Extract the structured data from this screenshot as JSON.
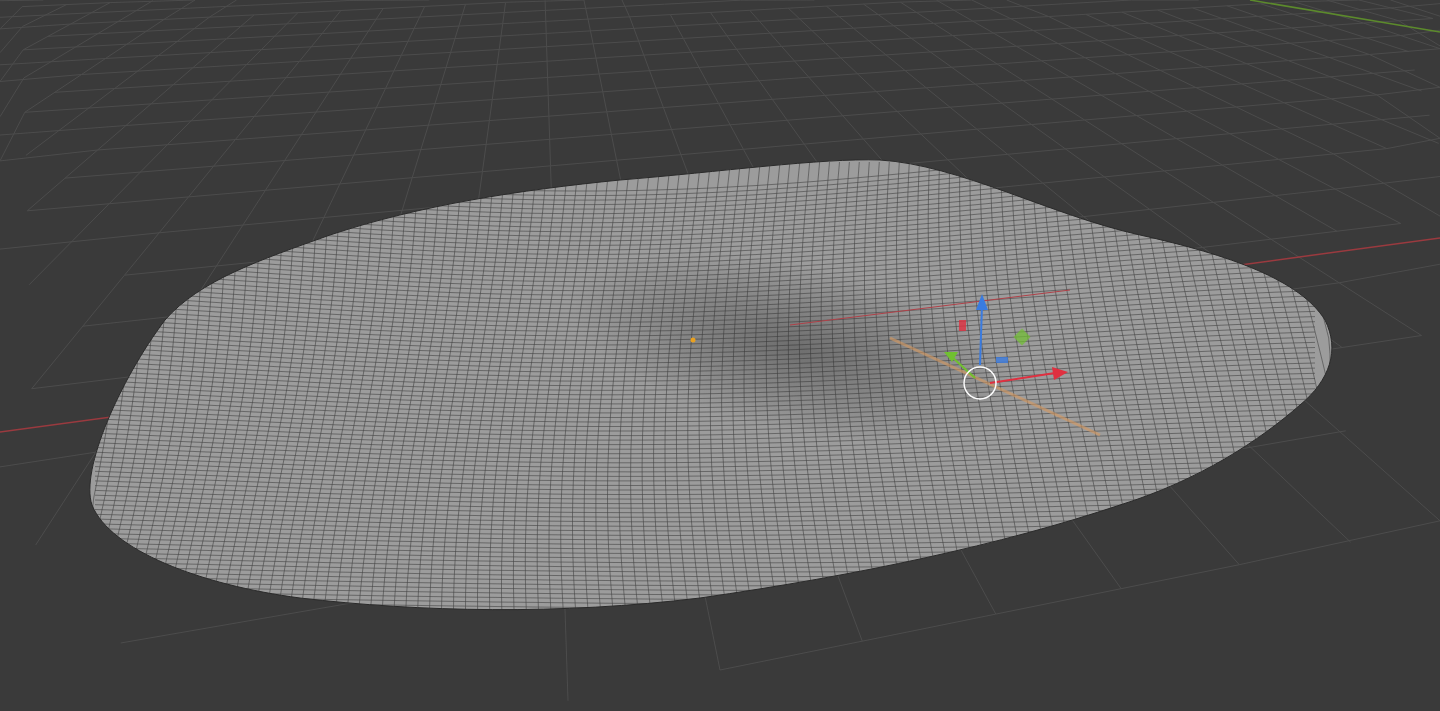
{
  "viewport": {
    "show_floor_grid": true,
    "show_transform_gizmo": true
  }
}
